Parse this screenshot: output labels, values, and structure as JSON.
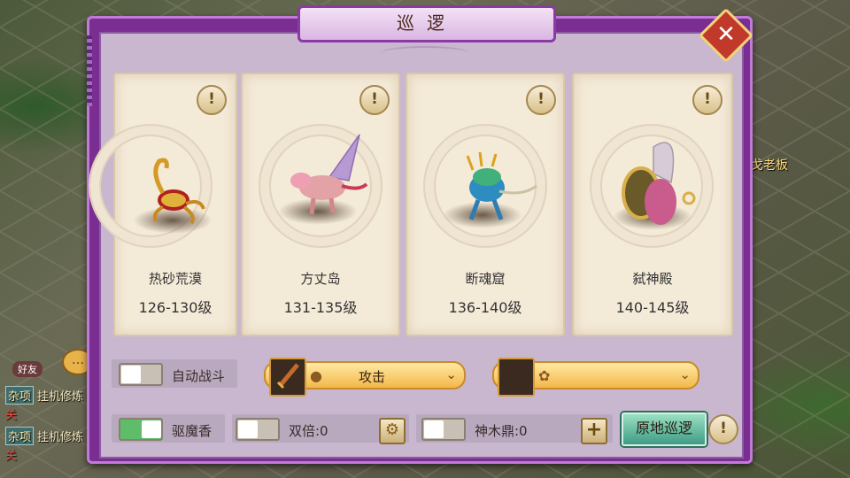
{
  "window": {
    "title": "巡逻",
    "close_label": "✕"
  },
  "hud": {
    "friend_label": "好友",
    "chat_icon": "…",
    "lines": [
      {
        "tag": "杂项",
        "text": "挂机修炼"
      },
      {
        "tag": "杂项",
        "text": "挂机修炼"
      }
    ],
    "red_mark": "关",
    "right_text": "戈老板"
  },
  "cards": [
    {
      "name": "热砂荒漠",
      "level": "126-130级",
      "info": "!",
      "monster_icon": "scorpion-icon"
    },
    {
      "name": "方丈岛",
      "level": "131-135级",
      "info": "!",
      "monster_icon": "winged-beast-icon"
    },
    {
      "name": "断魂窟",
      "level": "136-140级",
      "info": "!",
      "monster_icon": "fish-demon-icon"
    },
    {
      "name": "弑神殿",
      "level": "140-145级",
      "info": "!",
      "monster_icon": "shield-warrior-icon"
    }
  ],
  "controls": {
    "auto_battle": {
      "label": "自动战斗",
      "on": false
    },
    "skill_select": {
      "value": "攻击",
      "icon": "sword-icon"
    },
    "pet_select": {
      "value": "",
      "icon": "paw-icon"
    },
    "incense": {
      "label": "驱魔香",
      "on": true
    },
    "double": {
      "label": "双倍:0",
      "on": false
    },
    "cauldron": {
      "label": "神木鼎:0",
      "on": false
    },
    "patrol_button": "原地巡逻",
    "info_button": "!"
  },
  "colors": {
    "frame": "#7a2e91",
    "panel": "#c9b7d0",
    "card": "#f4ead8",
    "accent": "#f3b84a",
    "toggle_on": "#5fbd6a",
    "patrol_button": "#3e9c84"
  }
}
